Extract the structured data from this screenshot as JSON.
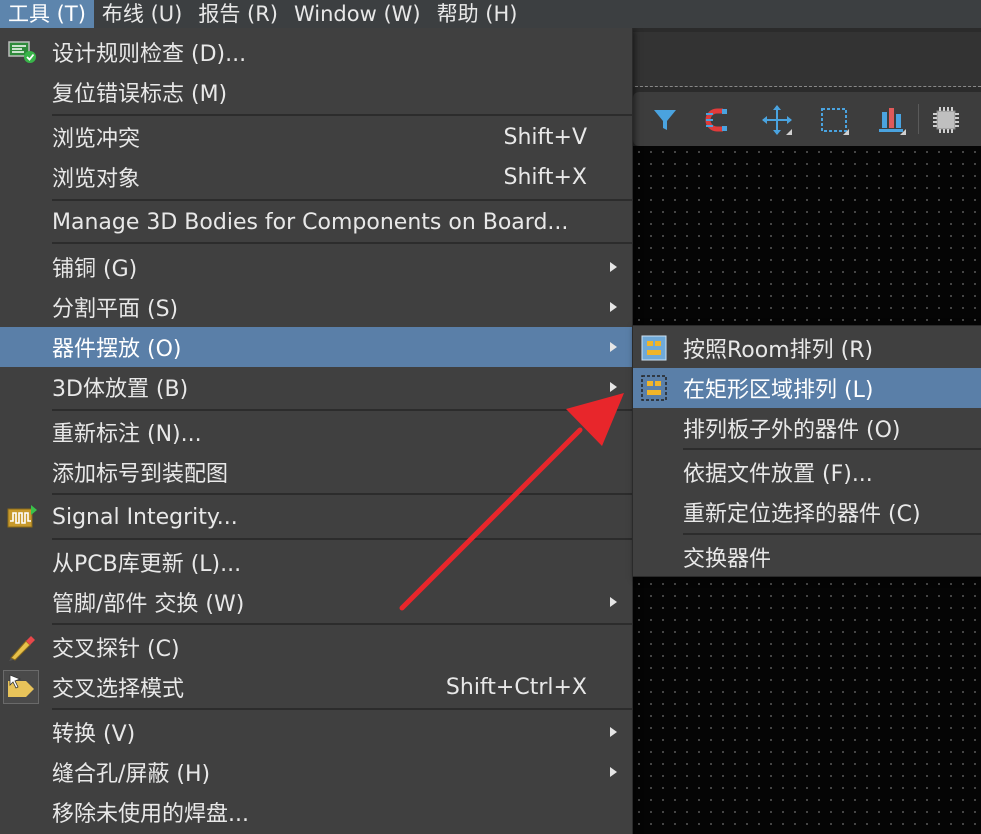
{
  "menubar": {
    "items": [
      "工具 (T)",
      "布线 (U)",
      "报告 (R)",
      "Window (W)",
      "帮助 (H)"
    ]
  },
  "tools_menu": {
    "items": [
      {
        "label": "设计规则检查 (D)...",
        "shortcut": "",
        "icon": "drc-check-icon"
      },
      {
        "label": "复位错误标志 (M)",
        "shortcut": ""
      },
      {
        "label": "浏览冲突",
        "shortcut": "Shift+V"
      },
      {
        "label": "浏览对象",
        "shortcut": "Shift+X"
      },
      {
        "label": "Manage 3D Bodies for Components on Board...",
        "shortcut": ""
      },
      {
        "label": "铺铜 (G)",
        "submenu": true
      },
      {
        "label": "分割平面 (S)",
        "submenu": true
      },
      {
        "label": "器件摆放 (O)",
        "submenu": true,
        "highlighted": true
      },
      {
        "label": "3D体放置 (B)",
        "submenu": true
      },
      {
        "label": "重新标注 (N)...",
        "shortcut": ""
      },
      {
        "label": "添加标号到装配图",
        "shortcut": ""
      },
      {
        "label": "Signal Integrity...",
        "icon": "signal-integrity-icon"
      },
      {
        "label": "从PCB库更新 (L)...",
        "shortcut": ""
      },
      {
        "label": "管脚/部件 交换 (W)",
        "submenu": true
      },
      {
        "label": "交叉探针 (C)",
        "icon": "cross-probe-icon"
      },
      {
        "label": "交叉选择模式",
        "shortcut": "Shift+Ctrl+X",
        "icon": "cross-select-icon"
      },
      {
        "label": "转换 (V)",
        "submenu": true
      },
      {
        "label": "缝合孔/屏蔽 (H)",
        "submenu": true
      },
      {
        "label": "移除未使用的焊盘...",
        "shortcut": ""
      }
    ]
  },
  "placement_submenu": {
    "items": [
      {
        "label": "按照Room排列 (R)",
        "icon": "arrange-room-icon"
      },
      {
        "label": "在矩形区域排列 (L)",
        "icon": "arrange-rectangle-icon",
        "highlighted": true
      },
      {
        "label": "排列板子外的器件 (O)"
      },
      {
        "label": "依据文件放置 (F)..."
      },
      {
        "label": "重新定位选择的器件 (C)"
      },
      {
        "label": "交换器件"
      }
    ]
  },
  "toolbar": {
    "icons": [
      "filter-icon",
      "route-magnet-icon",
      "move-icon",
      "select-rect-icon",
      "align-icon",
      "component-icon"
    ]
  },
  "annotation": {
    "color": "#e8262b",
    "shape": "arrow"
  }
}
